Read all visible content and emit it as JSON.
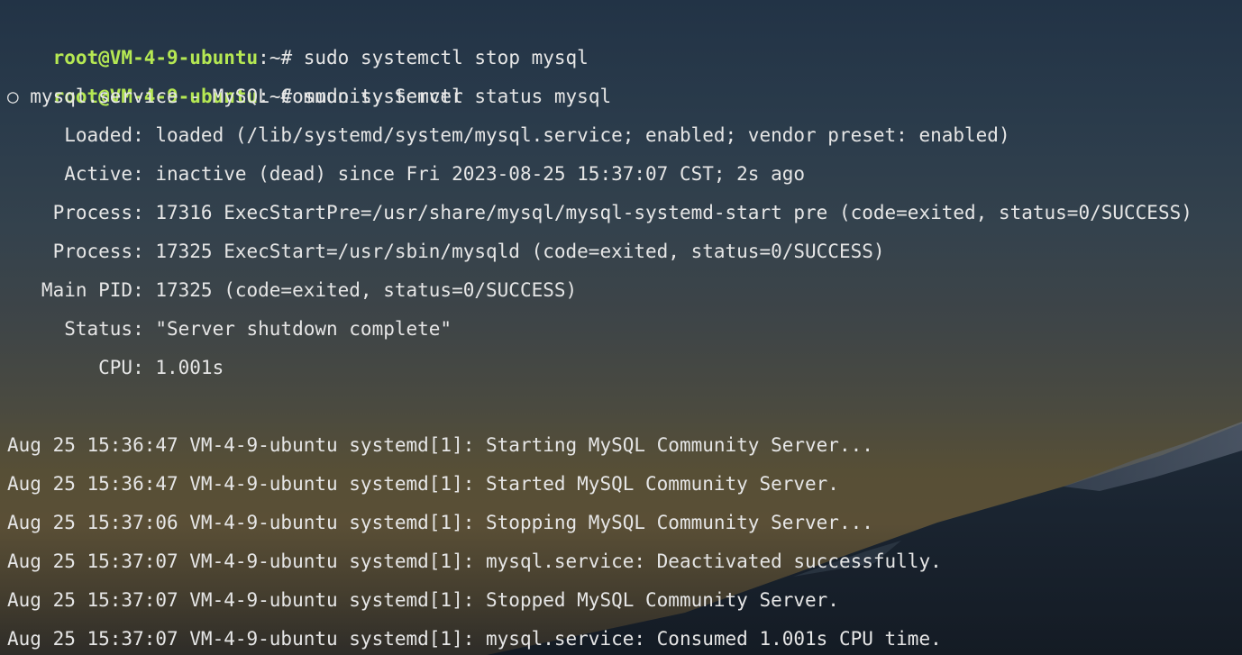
{
  "theme": {
    "prompt_user_color": "#b5e853",
    "text_color": "#e6e6e6"
  },
  "prompts": [
    {
      "user": "root@VM-4-9-ubuntu",
      "separator": ":",
      "path": "~#",
      "command": " sudo systemctl stop mysql"
    },
    {
      "user": "root@VM-4-9-ubuntu",
      "separator": ":",
      "path": "~#",
      "command": " sudo systemctl status mysql"
    }
  ],
  "status_output": [
    "○ mysql.service - MySQL Community Server",
    "     Loaded: loaded (/lib/systemd/system/mysql.service; enabled; vendor preset: enabled)",
    "     Active: inactive (dead) since Fri 2023-08-25 15:37:07 CST; 2s ago",
    "    Process: 17316 ExecStartPre=/usr/share/mysql/mysql-systemd-start pre (code=exited, status=0/SUCCESS)",
    "    Process: 17325 ExecStart=/usr/sbin/mysqld (code=exited, status=0/SUCCESS)",
    "   Main PID: 17325 (code=exited, status=0/SUCCESS)",
    "     Status: \"Server shutdown complete\"",
    "        CPU: 1.001s"
  ],
  "journal": [
    "Aug 25 15:36:47 VM-4-9-ubuntu systemd[1]: Starting MySQL Community Server...",
    "Aug 25 15:36:47 VM-4-9-ubuntu systemd[1]: Started MySQL Community Server.",
    "Aug 25 15:37:06 VM-4-9-ubuntu systemd[1]: Stopping MySQL Community Server...",
    "Aug 25 15:37:07 VM-4-9-ubuntu systemd[1]: mysql.service: Deactivated successfully.",
    "Aug 25 15:37:07 VM-4-9-ubuntu systemd[1]: Stopped MySQL Community Server.",
    "Aug 25 15:37:07 VM-4-9-ubuntu systemd[1]: mysql.service: Consumed 1.001s CPU time."
  ]
}
